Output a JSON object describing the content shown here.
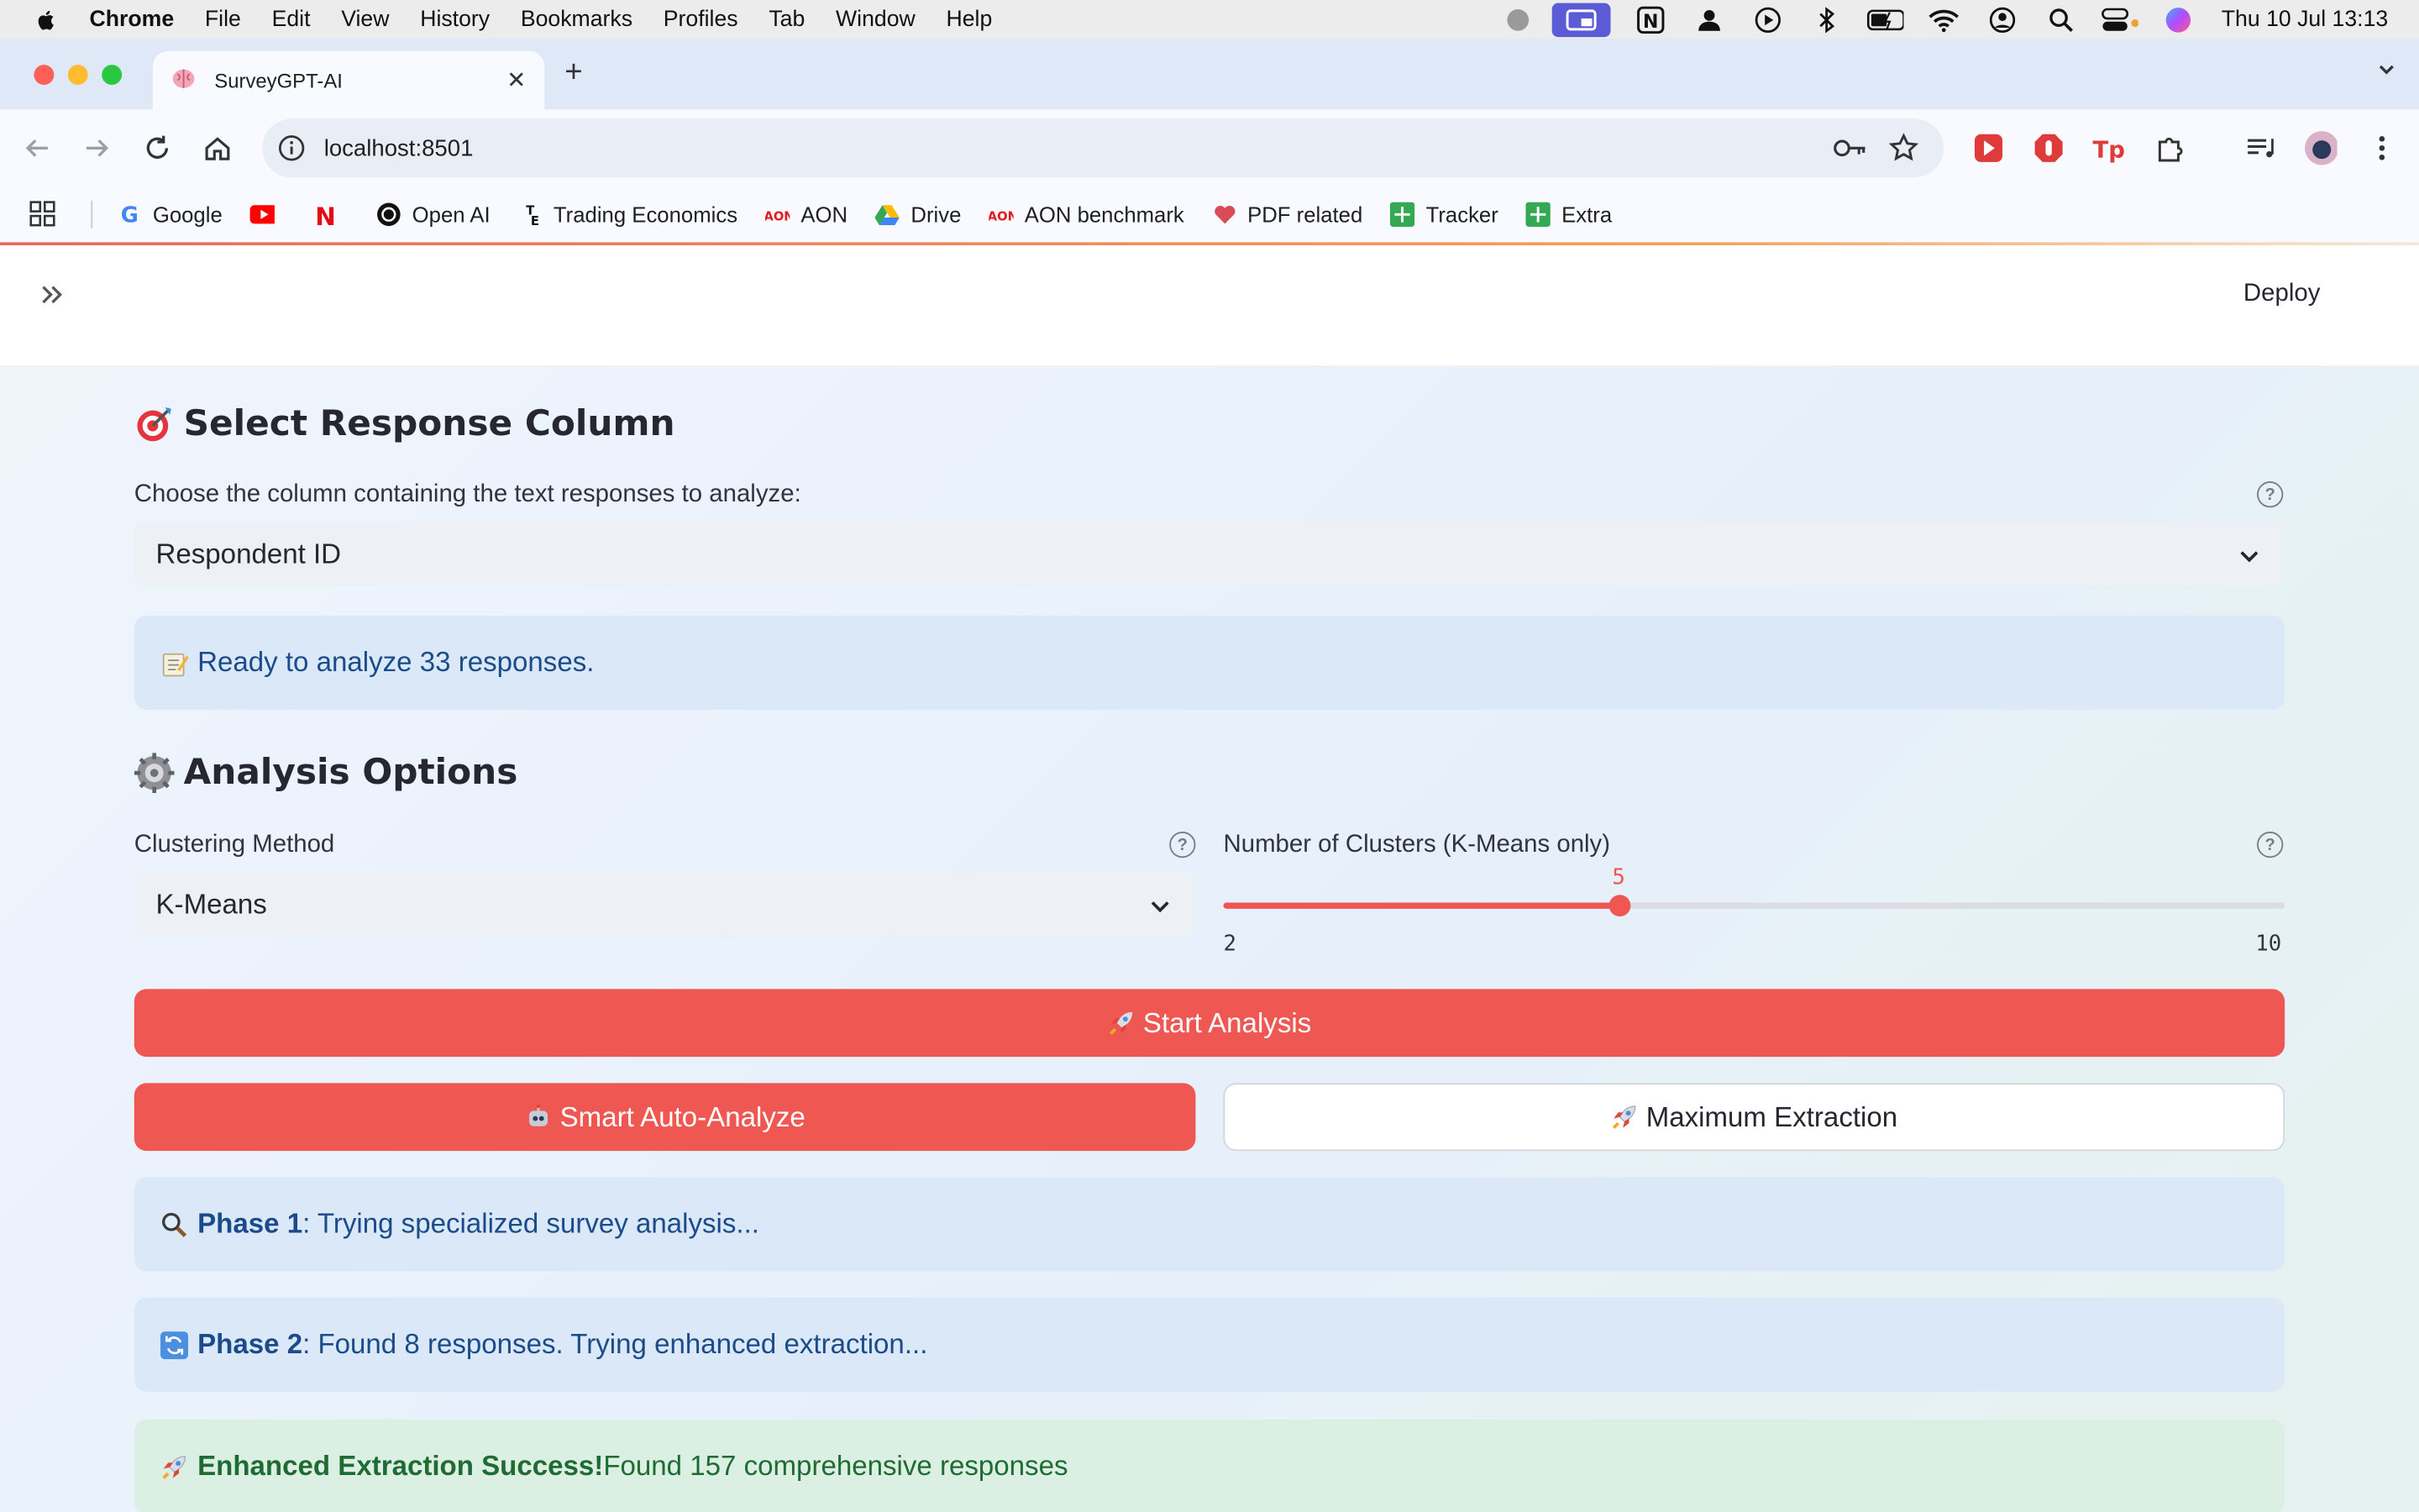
{
  "menubar": {
    "app": "Chrome",
    "items": [
      "File",
      "Edit",
      "View",
      "History",
      "Bookmarks",
      "Profiles",
      "Tab",
      "Window",
      "Help"
    ],
    "clock": "Thu 10 Jul  13:13"
  },
  "browser": {
    "tab_title": "SurveyGPT-AI",
    "url": "localhost:8501",
    "bookmarks": [
      "Google",
      "Open AI",
      "Trading Economics",
      "AON",
      "Drive",
      "AON benchmark",
      "PDF related",
      "Tracker",
      "Extra"
    ]
  },
  "app": {
    "deploy_label": "Deploy",
    "section1": {
      "title": "Select Response Column",
      "column_label": "Choose the column containing the text responses to analyze:",
      "column_value": "Respondent ID",
      "ready_text": "Ready to analyze 33 responses."
    },
    "section2": {
      "title": "Analysis Options",
      "method_label": "Clustering Method",
      "method_value": "K-Means",
      "clusters_label": "Number of Clusters (K-Means only)",
      "clusters_value": "5",
      "clusters_min": "2",
      "clusters_max": "10"
    },
    "buttons": {
      "start": "Start Analysis",
      "smart": "Smart Auto-Analyze",
      "max": "Maximum Extraction"
    },
    "messages": {
      "phase1_bold": "Phase 1",
      "phase1_text": ": Trying specialized survey analysis...",
      "phase2_bold": "Phase 2",
      "phase2_text": ": Found 8 responses. Trying enhanced extraction...",
      "success_bold": "Enhanced Extraction Success!",
      "success_text": " Found 157 comprehensive responses"
    }
  },
  "colors": {
    "accent": "#ef5753",
    "info_bg": "#dbe8f8",
    "success_bg": "#dcefe3"
  }
}
